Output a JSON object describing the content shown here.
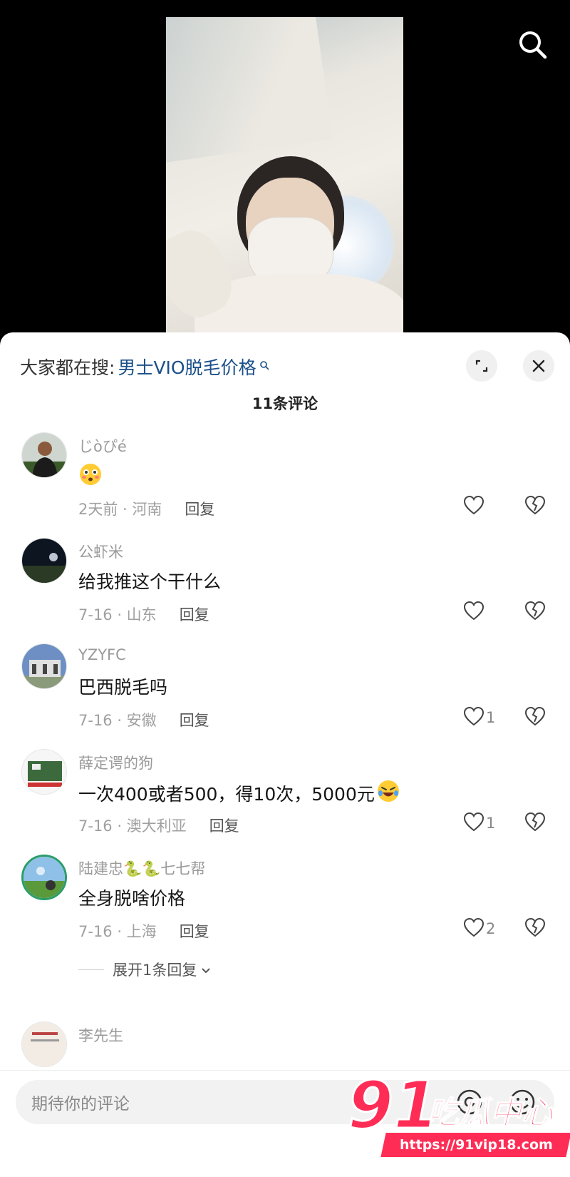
{
  "hot_search": {
    "prefix": "大家都在搜:",
    "keyword": "男士VIO脱毛价格"
  },
  "comment_count": "11条评论",
  "comments": [
    {
      "username": "じòぴé",
      "text": "",
      "emoji": "flushed-face-emoji",
      "date": "2天前 · 河南",
      "reply": "回复",
      "likes": ""
    },
    {
      "username": "公虾米",
      "text": "给我推这个干什么",
      "date": "7-16 · 山东",
      "reply": "回复",
      "likes": ""
    },
    {
      "username": "YZYFC",
      "text": "巴西脱毛吗",
      "date": "7-16 · 安徽",
      "reply": "回复",
      "likes": "1"
    },
    {
      "username": "薛定谔的狗",
      "text": "一次400或者500，得10次，5000元",
      "emoji": "rolling-laughing-emoji",
      "date": "7-16 · 澳大利亚",
      "reply": "回复",
      "likes": "1"
    },
    {
      "username": "陆建忠🐍🐍七七帮",
      "text": "全身脱啥价格",
      "date": "7-16 · 上海",
      "reply": "回复",
      "likes": "2"
    },
    {
      "username": "李先生",
      "text": "",
      "date": "",
      "reply": "",
      "likes": ""
    }
  ],
  "expand_replies": "展开1条回复",
  "input": {
    "placeholder": "期待你的评论"
  },
  "watermark": {
    "number": "91",
    "brand": "吃瓜中心",
    "url": "https://91vip18.com"
  },
  "icons": [
    "search-icon",
    "expand-icon",
    "close-icon",
    "heart-icon",
    "broken-heart-icon",
    "at-icon",
    "emoji-icon",
    "chevron-down-icon"
  ]
}
